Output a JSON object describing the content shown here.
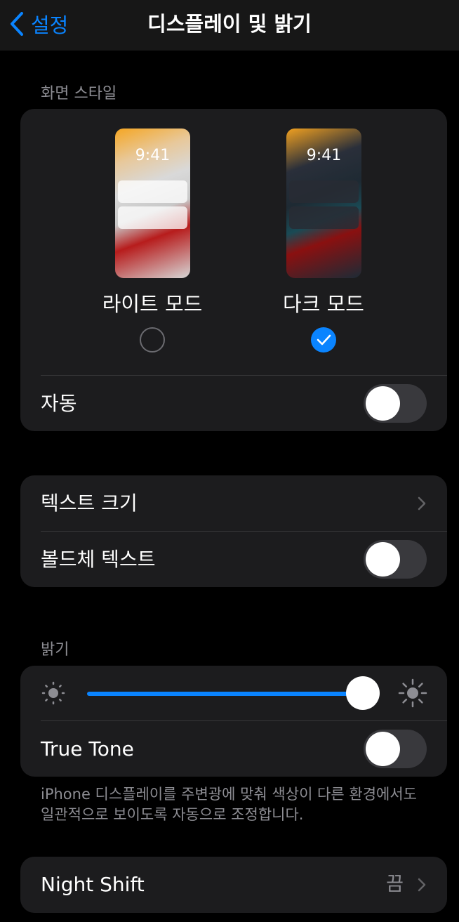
{
  "nav": {
    "back_label": "설정",
    "title": "디스플레이 및 밝기"
  },
  "appearance": {
    "header": "화면 스타일",
    "light": {
      "label": "라이트 모드",
      "time": "9:41",
      "selected": false
    },
    "dark": {
      "label": "다크 모드",
      "time": "9:41",
      "selected": true
    },
    "auto_label": "자동",
    "auto_on": false
  },
  "text": {
    "text_size_label": "텍스트 크기",
    "bold_label": "볼드체 텍스트",
    "bold_on": false
  },
  "brightness": {
    "header": "밝기",
    "level": 1.0,
    "true_tone_label": "True Tone",
    "true_tone_on": false,
    "footer": "iPhone 디스플레이를 주변광에 맞춰 색상이 다른 환경에서도 일관적으로 보이도록 자동으로 조정합니다."
  },
  "night_shift": {
    "label": "Night Shift",
    "value": "끔"
  },
  "colors": {
    "accent": "#0a84ff",
    "background": "#000000",
    "group": "#1c1c1e",
    "secondary": "#8d8d93"
  }
}
